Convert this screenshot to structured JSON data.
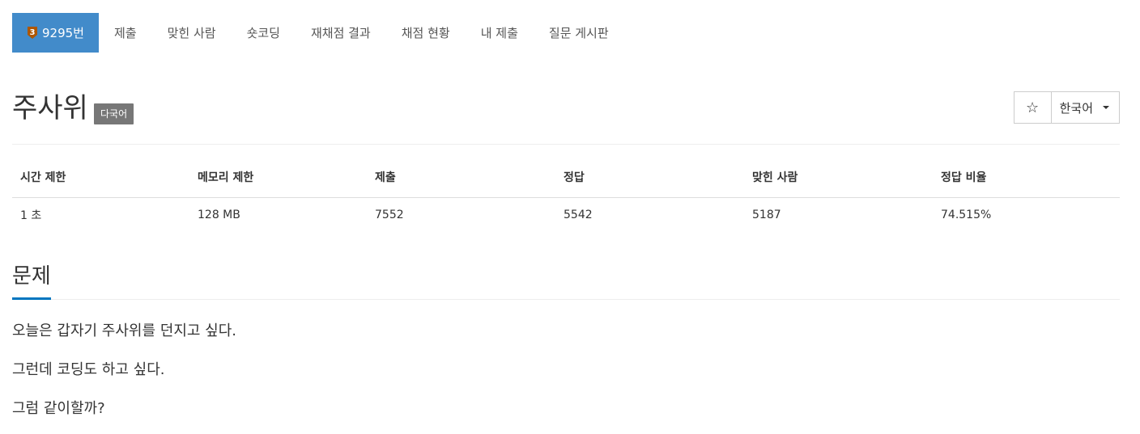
{
  "nav": {
    "tabs": [
      {
        "label": "9295번",
        "active": true,
        "tier_level": "3",
        "tier_color": "#ad5600"
      },
      {
        "label": "제출"
      },
      {
        "label": "맞힌 사람"
      },
      {
        "label": "숏코딩"
      },
      {
        "label": "재채점 결과"
      },
      {
        "label": "채점 현황"
      },
      {
        "label": "내 제출"
      },
      {
        "label": "질문 게시판"
      }
    ],
    "active_color": "#428bca"
  },
  "problem": {
    "title": "주사위",
    "multilang_label": "다국어",
    "star_icon": "☆",
    "language_selected": "한국어"
  },
  "info_table": {
    "headers": [
      "시간 제한",
      "메모리 제한",
      "제출",
      "정답",
      "맞힌 사람",
      "정답 비율"
    ],
    "values": [
      "1 초",
      "128 MB",
      "7552",
      "5542",
      "5187",
      "74.515%"
    ]
  },
  "section": {
    "title": "문제",
    "accent_color": "#0076c0"
  },
  "body": {
    "paragraphs": [
      "오늘은 갑자기 주사위를 던지고 싶다.",
      "그런데 코딩도 하고 싶다.",
      "그럼 같이할까?"
    ]
  }
}
